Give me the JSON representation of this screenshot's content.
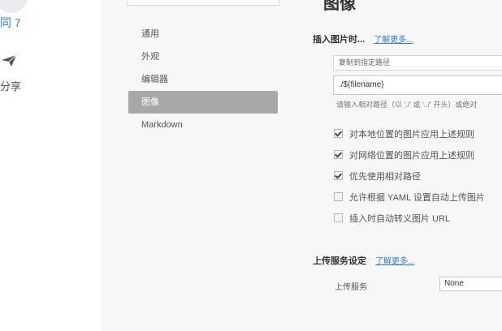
{
  "left_panel": {
    "sync_label": "同 7",
    "share_label": "分享"
  },
  "sidebar": {
    "items": [
      {
        "label": "通用"
      },
      {
        "label": "外观"
      },
      {
        "label": "编辑器"
      },
      {
        "label": "图像"
      },
      {
        "label": "Markdown"
      }
    ],
    "active_index": 3
  },
  "page": {
    "title": "图像"
  },
  "insert_section": {
    "title": "插入图片时...",
    "learn_more": "了解更多...",
    "action_select": "复制到指定路径",
    "path_value": "./${filename}",
    "hint": "请输入相对路径（以 './' 或 '../' 开头）或绝对"
  },
  "checkboxes": [
    {
      "label": "对本地位置的图片应用上述规则",
      "checked": true
    },
    {
      "label": "对网络位置的图片应用上述规则",
      "checked": true
    },
    {
      "label": "优先使用相对路径",
      "checked": true
    },
    {
      "label": "允许根据 YAML 设置自动上传图片",
      "checked": false
    },
    {
      "label": "插入时自动转义图片 URL",
      "checked": false
    }
  ],
  "upload_section": {
    "title": "上传服务设定",
    "learn_more": "了解更多...",
    "service_label": "上传服务",
    "service_value": "None"
  },
  "colors": {
    "accent": "#2f7fd1",
    "active_sidebar": "#a8a8a8",
    "panel_bg": "#f7f7f7"
  }
}
